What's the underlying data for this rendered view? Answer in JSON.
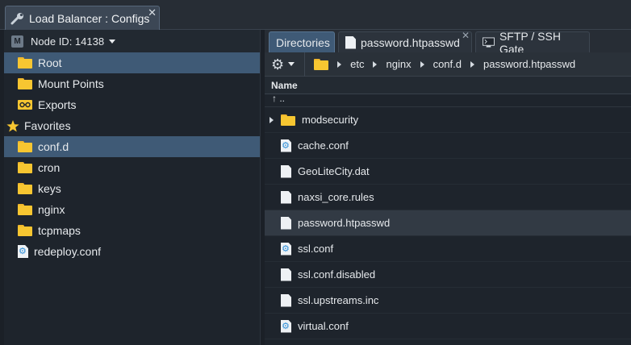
{
  "window": {
    "title": "Load Balancer : Configs",
    "close_glyph": "✕"
  },
  "left": {
    "node_badge": "M",
    "node_label": "Node ID: 14138",
    "roots": [
      {
        "label": "Root",
        "icon": "folder-icon",
        "selected": true
      },
      {
        "label": "Mount Points",
        "icon": "folder-icon"
      },
      {
        "label": "Exports",
        "icon": "exports-icon"
      }
    ],
    "favorites_label": "Favorites",
    "favorites": [
      {
        "label": "conf.d",
        "icon": "folder-icon",
        "selected": true
      },
      {
        "label": "cron",
        "icon": "folder-icon"
      },
      {
        "label": "keys",
        "icon": "folder-icon"
      },
      {
        "label": "nginx",
        "icon": "folder-icon"
      },
      {
        "label": "tcpmaps",
        "icon": "folder-icon"
      },
      {
        "label": "redeploy.conf",
        "icon": "config-file-icon"
      }
    ]
  },
  "tabs": [
    {
      "label": "Directories",
      "active": true
    },
    {
      "label": "password.htpasswd",
      "icon": "file-icon"
    },
    {
      "label": "SFTP / SSH Gate",
      "icon": "terminal-icon"
    }
  ],
  "breadcrumb": [
    "etc",
    "nginx",
    "conf.d",
    "password.htpasswd"
  ],
  "list": {
    "column_name": "Name",
    "up_label": "↑ ..",
    "rows": [
      {
        "label": "modsecurity",
        "type": "folder"
      },
      {
        "label": "cache.conf",
        "type": "conf"
      },
      {
        "label": "GeoLiteCity.dat",
        "type": "file"
      },
      {
        "label": "naxsi_core.rules",
        "type": "file"
      },
      {
        "label": "password.htpasswd",
        "type": "file",
        "hover": true
      },
      {
        "label": "ssl.conf",
        "type": "conf"
      },
      {
        "label": "ssl.conf.disabled",
        "type": "file"
      },
      {
        "label": "ssl.upstreams.inc",
        "type": "file"
      },
      {
        "label": "virtual.conf",
        "type": "conf"
      }
    ]
  },
  "colors": {
    "accent": "#3f5a76",
    "folder": "#f7c631",
    "config": "#2f8fd8"
  }
}
